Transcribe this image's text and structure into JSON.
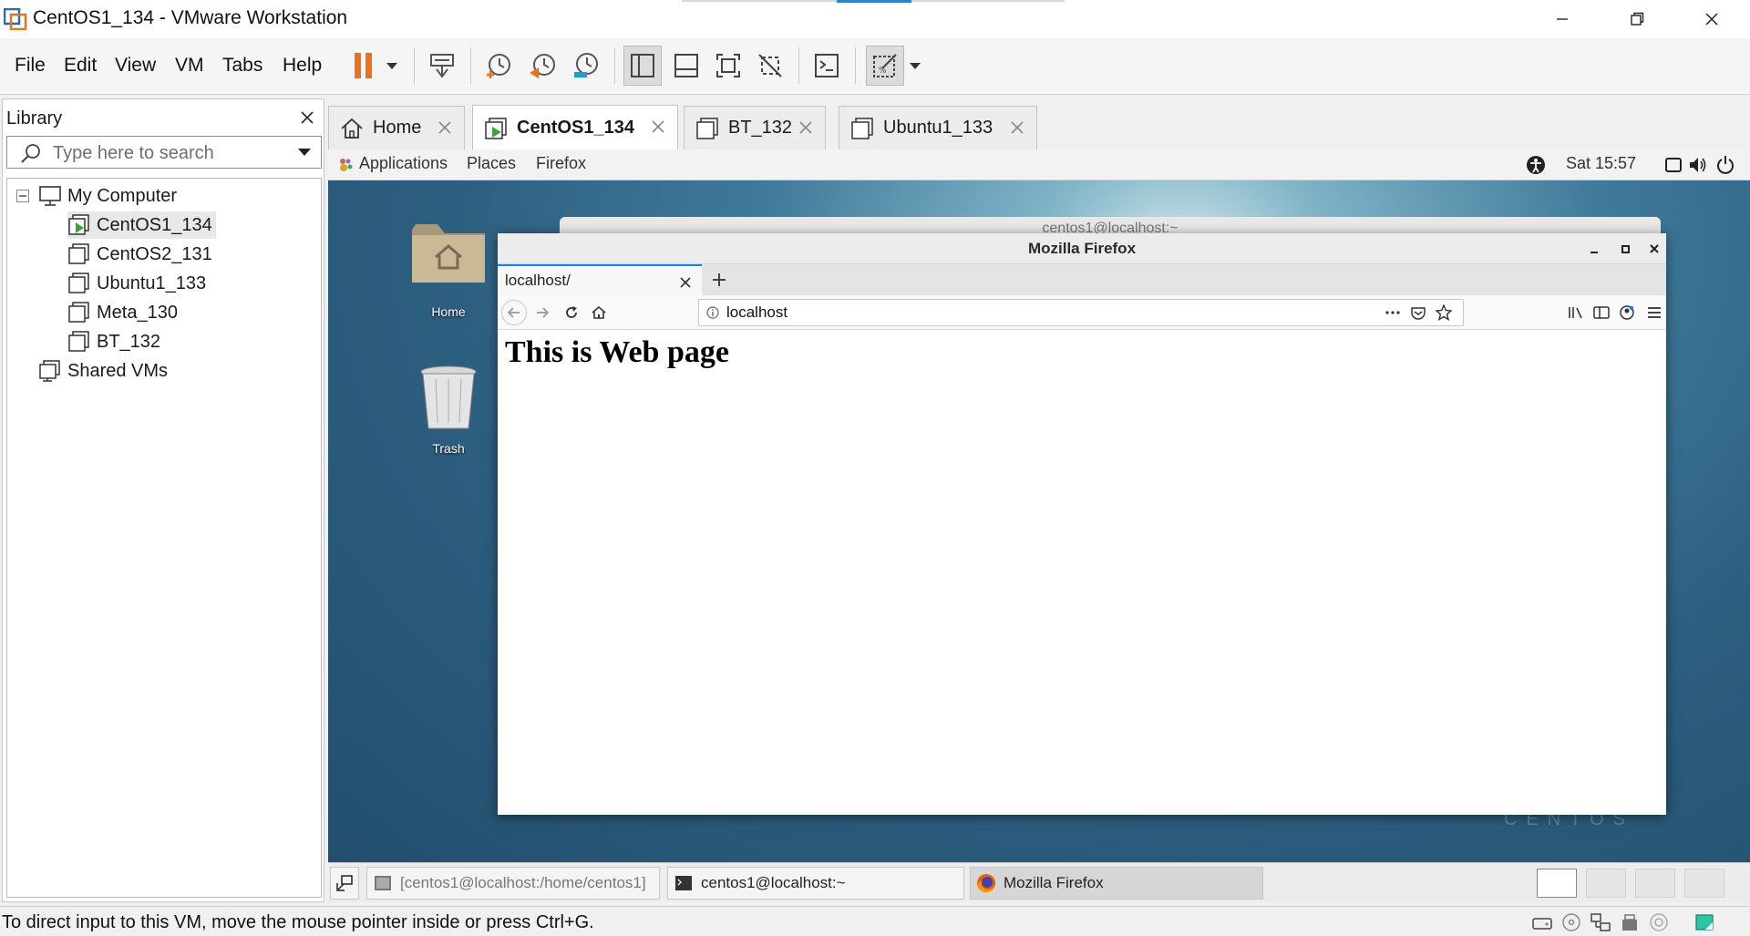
{
  "window": {
    "title": "CentOS1_134 - VMware Workstation"
  },
  "menu": [
    "File",
    "Edit",
    "View",
    "VM",
    "Tabs",
    "Help"
  ],
  "library": {
    "title": "Library",
    "search_placeholder": "Type here to search",
    "tree": {
      "root": "My Computer",
      "vms": [
        "CentOS1_134",
        "CentOS2_131",
        "Ubuntu1_133",
        "Meta_130",
        "BT_132"
      ],
      "shared": "Shared VMs"
    }
  },
  "vm_tabs": [
    {
      "label": "Home"
    },
    {
      "label": "CentOS1_134"
    },
    {
      "label": "BT_132"
    },
    {
      "label": "Ubuntu1_133"
    }
  ],
  "guest": {
    "topbar": {
      "applications": "Applications",
      "places": "Places",
      "firefox": "Firefox",
      "clock": "Sat 15:57"
    },
    "desktop_icons": {
      "home": "Home",
      "trash": "Trash"
    },
    "watermark": "CENTOS",
    "bg_window_title": "centos1@localhost:~",
    "firefox": {
      "window_title": "Mozilla Firefox",
      "tab_label": "localhost/",
      "url": "localhost",
      "page_heading": "This is Web page"
    },
    "taskbar": [
      "[centos1@localhost:/home/centos1]",
      "centos1@localhost:~",
      "Mozilla Firefox"
    ]
  },
  "status": {
    "message": "To direct input to this VM, move the mouse pointer inside or press Ctrl+G."
  },
  "colors": {
    "accent_orange": "#e8731c",
    "firefox_tab_accent": "#0a84ff",
    "vm_running_green": "#3aa63a"
  }
}
